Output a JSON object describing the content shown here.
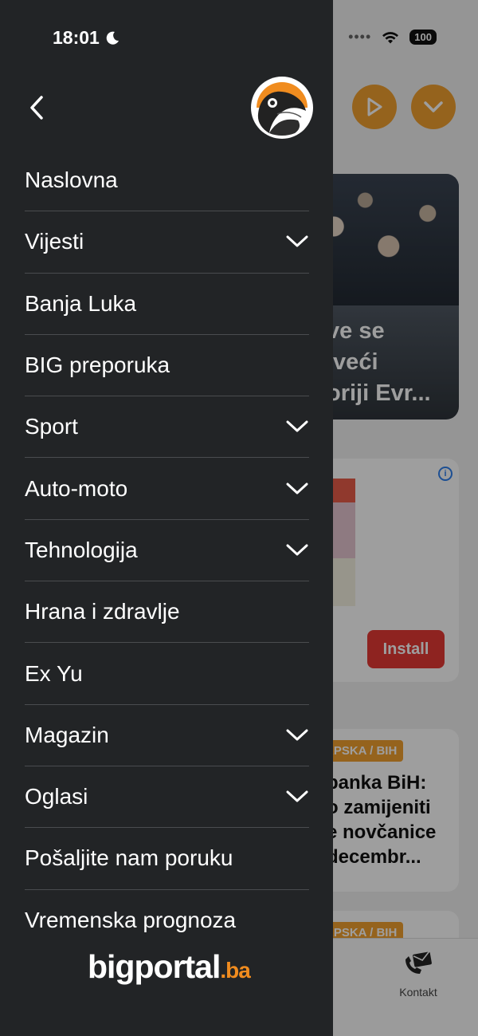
{
  "status_bar": {
    "time": "18:01",
    "battery": "100"
  },
  "background": {
    "hero_title_lines": [
      "ve se",
      "jveći",
      "oriji Evr..."
    ],
    "ad": {
      "install_label": "Install"
    },
    "news": [
      {
        "tag": "RPSKA / BIH",
        "title_lines": [
          "banka BiH:",
          "o zamijeniti",
          "e novčanice",
          "decembr..."
        ]
      },
      {
        "tag": "RPSKA / BIH"
      }
    ],
    "tabbar": {
      "contact_label": "Kontakt"
    }
  },
  "drawer": {
    "menu": [
      {
        "label": "Naslovna",
        "expandable": false
      },
      {
        "label": "Vijesti",
        "expandable": true
      },
      {
        "label": "Banja Luka",
        "expandable": false
      },
      {
        "label": "BIG preporuka",
        "expandable": false
      },
      {
        "label": "Sport",
        "expandable": true
      },
      {
        "label": "Auto-moto",
        "expandable": true
      },
      {
        "label": "Tehnologija",
        "expandable": true
      },
      {
        "label": "Hrana i zdravlje",
        "expandable": false
      },
      {
        "label": "Ex Yu",
        "expandable": false
      },
      {
        "label": "Magazin",
        "expandable": true
      },
      {
        "label": "Oglasi",
        "expandable": true
      },
      {
        "label": "Pošaljite nam poruku",
        "expandable": false
      },
      {
        "label": "Vremenska prognoza",
        "expandable": false
      }
    ],
    "brand": {
      "name": "bigportal",
      "tld": ".ba"
    }
  },
  "colors": {
    "drawer_bg": "#222426",
    "accent": "#f0a030",
    "brand_orange": "#f08c1f",
    "install_red": "#e53935"
  }
}
